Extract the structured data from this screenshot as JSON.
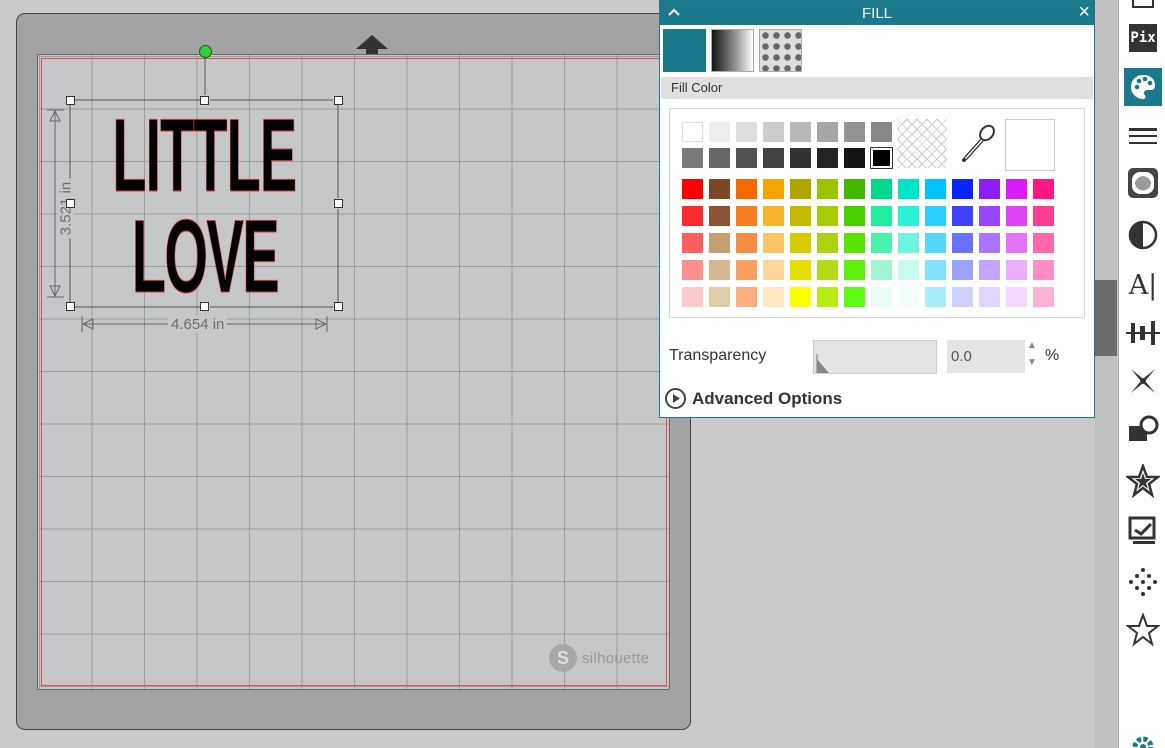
{
  "mat": {
    "brand": "silhouette",
    "brand_mark": "S"
  },
  "design": {
    "line_1": "LITTLE",
    "line_2": "LOVE",
    "height_label": "3.521 in",
    "width_label": "4.654 in"
  },
  "fill_panel": {
    "title": "FILL",
    "section_label": "Fill Color",
    "transparency_label": "Transparency",
    "transparency_value": "0.0",
    "transparency_unit": "%",
    "advanced_label": "Advanced Options",
    "grays_row_1": [
      "#ffffff",
      "#ededed",
      "#dedede",
      "#cccccc",
      "#b8b8b8",
      "#a6a6a6",
      "#949494",
      "#878787"
    ],
    "grays_row_2": [
      "#7a7a7a",
      "#666666",
      "#525252",
      "#424242",
      "#333333",
      "#242424",
      "#141414",
      "#000000"
    ],
    "selected_swatch": "#000000",
    "colors": [
      [
        "#fc0000",
        "#7b4725",
        "#f56a00",
        "#f5a300",
        "#b4a400",
        "#9bc400",
        "#43b800",
        "#00d98c",
        "#00e3c4",
        "#00c3ff",
        "#0b24ff",
        "#8b1eff",
        "#d61ef2",
        "#ff1783"
      ],
      [
        "#fc2b2b",
        "#8a5434",
        "#f77d1e",
        "#f7b52c",
        "#c4b800",
        "#a7cd00",
        "#49d000",
        "#21eda0",
        "#2af2d6",
        "#2acfff",
        "#3c42ff",
        "#9a45ff",
        "#dd45f4",
        "#ff3d95"
      ],
      [
        "#fc5f5f",
        "#c59e72",
        "#f78d45",
        "#fbc565",
        "#d8cb00",
        "#aed112",
        "#5ae200",
        "#4af2ae",
        "#6df5e0",
        "#55d8ff",
        "#6872ff",
        "#ac74ff",
        "#e374f6",
        "#ff69ab"
      ],
      [
        "#fd8f8f",
        "#d6b592",
        "#f9a060",
        "#fcd79a",
        "#e7de00",
        "#b5da18",
        "#5ef00b",
        "#a2f7d2",
        "#c9fbf0",
        "#81e2fd",
        "#98a2ff",
        "#c5a5ff",
        "#ebaefa",
        "#ff8ec5"
      ],
      [
        "#fdcaca",
        "#e1cca8",
        "#fbae80",
        "#fce8c2",
        "#fcff00",
        "#b8ec12",
        "#5cfb14",
        "#e8fdf5",
        "#f2fffb",
        "#a9edfc",
        "#ccd1fe",
        "#e1d5ff",
        "#f5d9fc",
        "#ffb3d4"
      ]
    ]
  },
  "toolbar": {
    "items": [
      "layers-icon",
      "pixscan-icon",
      "fill-icon",
      "line-style-icon",
      "offset-icon",
      "contrast-icon",
      "text-style-icon",
      "align-icon",
      "transform-icon",
      "replicate-icon",
      "modify-icon",
      "trace-icon",
      "rhinestone-icon",
      "library-icon",
      "settings-icon"
    ],
    "pix_label": "Pix",
    "text_label": "A|"
  }
}
